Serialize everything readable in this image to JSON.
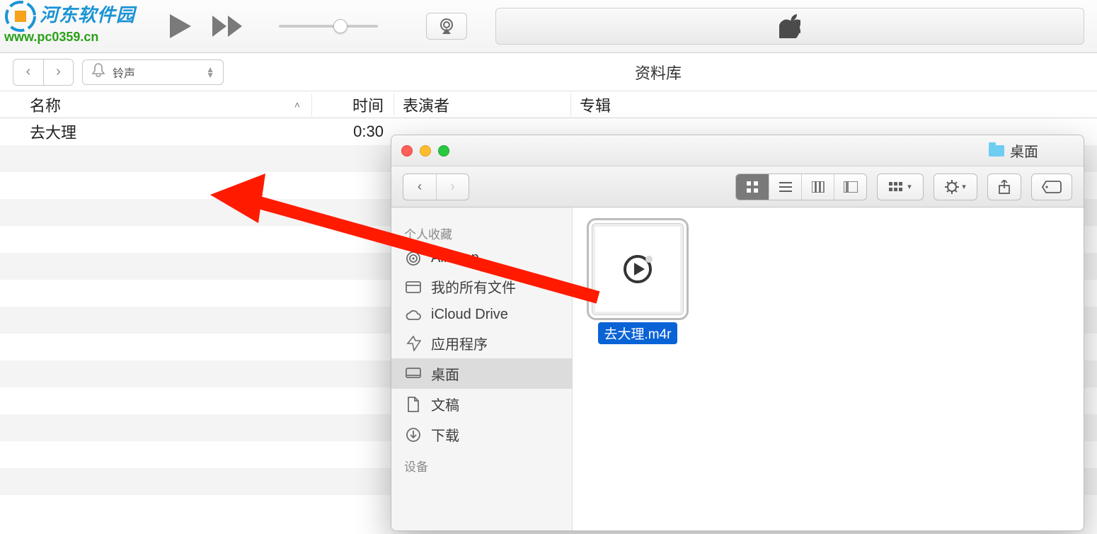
{
  "watermark": {
    "text": "河东软件园",
    "url": "www.pc0359.cn"
  },
  "itunes": {
    "media_label": "铃声",
    "lib_label": "资料库",
    "columns": {
      "name": "名称",
      "time": "时间",
      "artist": "表演者",
      "album": "专辑"
    },
    "rows": [
      {
        "name": "去大理",
        "time": "0:30"
      }
    ]
  },
  "finder": {
    "title": "桌面",
    "sidebar": {
      "section1": "个人收藏",
      "items": [
        {
          "icon": "airdrop",
          "label": "AirDrop"
        },
        {
          "icon": "allfiles",
          "label": "我的所有文件"
        },
        {
          "icon": "icloud",
          "label": "iCloud Drive"
        },
        {
          "icon": "apps",
          "label": "应用程序"
        },
        {
          "icon": "desktop",
          "label": "桌面",
          "selected": true
        },
        {
          "icon": "docs",
          "label": "文稿"
        },
        {
          "icon": "downloads",
          "label": "下载"
        }
      ],
      "section2": "设备"
    },
    "files": [
      {
        "name": "去大理.m4r",
        "selected": true
      }
    ]
  }
}
